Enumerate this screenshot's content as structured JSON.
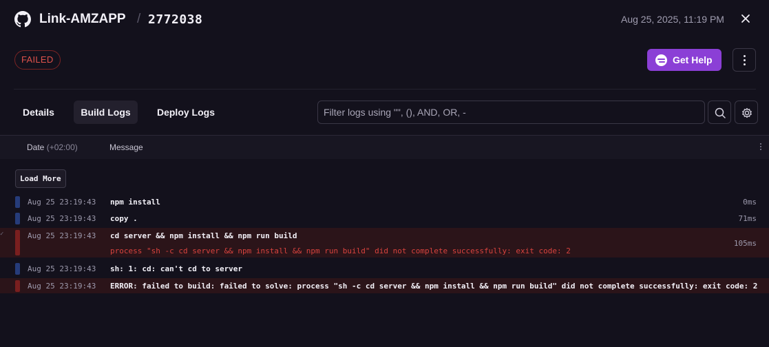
{
  "header": {
    "repo_name": "Link-AMZAPP",
    "separator": "/",
    "deployment_id": "2772038",
    "timestamp": "Aug 25, 2025, 11:19 PM",
    "close_icon": "close-icon"
  },
  "status": {
    "label": "FAILED",
    "color": "#e0534c"
  },
  "actions": {
    "get_help_label": "Get Help",
    "accent": "#8b3fd6"
  },
  "tabs": [
    {
      "label": "Details",
      "active": false
    },
    {
      "label": "Build Logs",
      "active": true
    },
    {
      "label": "Deploy Logs",
      "active": false
    }
  ],
  "filter": {
    "placeholder": "Filter logs using \"\", (), AND, OR, -",
    "value": ""
  },
  "columns": {
    "date": "Date",
    "timezone": "(+02:00)",
    "message": "Message"
  },
  "load_more_label": "Load More",
  "logs": [
    {
      "date": "Aug 25 23:19:43",
      "message": "npm install",
      "duration": "0ms",
      "level": "info"
    },
    {
      "date": "Aug 25 23:19:43",
      "message": "copy .",
      "duration": "71ms",
      "level": "info"
    },
    {
      "date": "Aug 25 23:19:43",
      "message": "cd server && npm install && npm run build",
      "detail": "process \"sh -c cd server && npm install && npm run build\" did not complete successfully: exit code: 2",
      "duration": "105ms",
      "level": "error"
    },
    {
      "date": "Aug 25 23:19:43",
      "message": "sh: 1: cd: can't cd to server",
      "duration": "",
      "level": "info"
    },
    {
      "date": "Aug 25 23:19:43",
      "message": "ERROR: failed to build: failed to solve: process \"sh -c cd server && npm install && npm run build\" did not complete successfully: exit code: 2",
      "duration": "",
      "level": "error"
    }
  ]
}
